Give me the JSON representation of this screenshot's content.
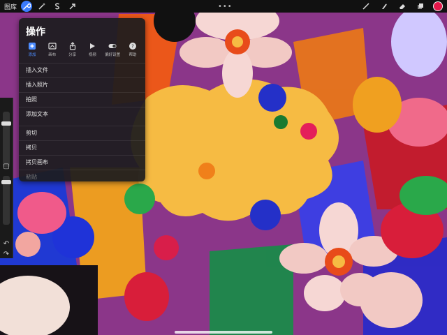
{
  "topbar": {
    "gallery_label": "图库",
    "more_dots": "•••",
    "color_swatch": "#e4174a",
    "accent": "#3a7bff"
  },
  "actions_panel": {
    "title": "操作",
    "tabs": [
      {
        "label": "添加",
        "icon": "add-icon",
        "active": true
      },
      {
        "label": "画布",
        "icon": "canvas-icon"
      },
      {
        "label": "分享",
        "icon": "share-icon"
      },
      {
        "label": "视频",
        "icon": "video-icon"
      },
      {
        "label": "偏好设置",
        "icon": "toggle-icon"
      },
      {
        "label": "帮助",
        "icon": "help-icon"
      }
    ],
    "group1": [
      "插入文件",
      "插入照片",
      "拍照",
      "添加文本"
    ],
    "group2": [
      "剪切",
      "拷贝",
      "拷贝画布",
      "粘贴"
    ]
  }
}
